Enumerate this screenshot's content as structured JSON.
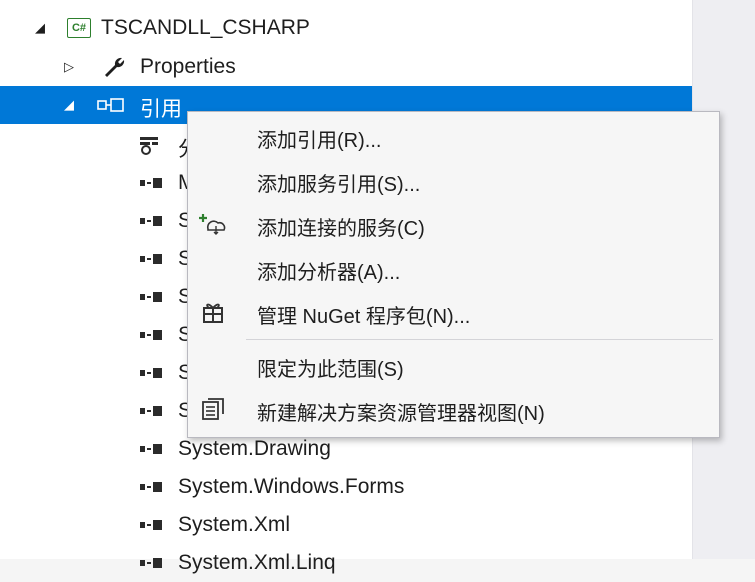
{
  "tree": {
    "project": {
      "label": "TSCANDLL_CSHARP",
      "icon": "csharp-project-icon",
      "icon_text": "C#",
      "expanded": true
    },
    "properties": {
      "label": "Properties",
      "icon": "wrench-icon"
    },
    "references": {
      "label": "引用",
      "icon": "references-icon",
      "selected": true
    },
    "items": [
      {
        "label": "分",
        "icon": "analyzers-icon"
      },
      {
        "label": "M",
        "icon": "assembly-reference-icon"
      },
      {
        "label": "S",
        "icon": "assembly-reference-icon"
      },
      {
        "label": "S",
        "icon": "assembly-reference-icon"
      },
      {
        "label": "S",
        "icon": "assembly-reference-icon"
      },
      {
        "label": "S",
        "icon": "assembly-reference-icon"
      },
      {
        "label": "S",
        "icon": "assembly-reference-icon"
      },
      {
        "label": "S",
        "icon": "assembly-reference-icon"
      },
      {
        "label": "System.Drawing",
        "icon": "assembly-reference-icon"
      },
      {
        "label": "System.Windows.Forms",
        "icon": "assembly-reference-icon"
      },
      {
        "label": "System.Xml",
        "icon": "assembly-reference-icon"
      },
      {
        "label": "System.Xml.Linq",
        "icon": "assembly-reference-icon"
      }
    ]
  },
  "context_menu": {
    "items": [
      {
        "label": "添加引用(R)...",
        "icon": ""
      },
      {
        "label": "添加服务引用(S)...",
        "icon": ""
      },
      {
        "label": "添加连接的服务(C)",
        "icon": "connected-service-icon"
      },
      {
        "label": "添加分析器(A)...",
        "icon": ""
      },
      {
        "label": "管理 NuGet 程序包(N)...",
        "icon": "nuget-package-icon"
      },
      {
        "label": "限定为此范围(S)",
        "icon": ""
      },
      {
        "label": "新建解决方案资源管理器视图(N)",
        "icon": "new-solution-explorer-view-icon"
      }
    ]
  },
  "colors": {
    "selection": "#0078d7",
    "menu_background": "#f6f6f6",
    "gutter": "#eeeef2"
  }
}
